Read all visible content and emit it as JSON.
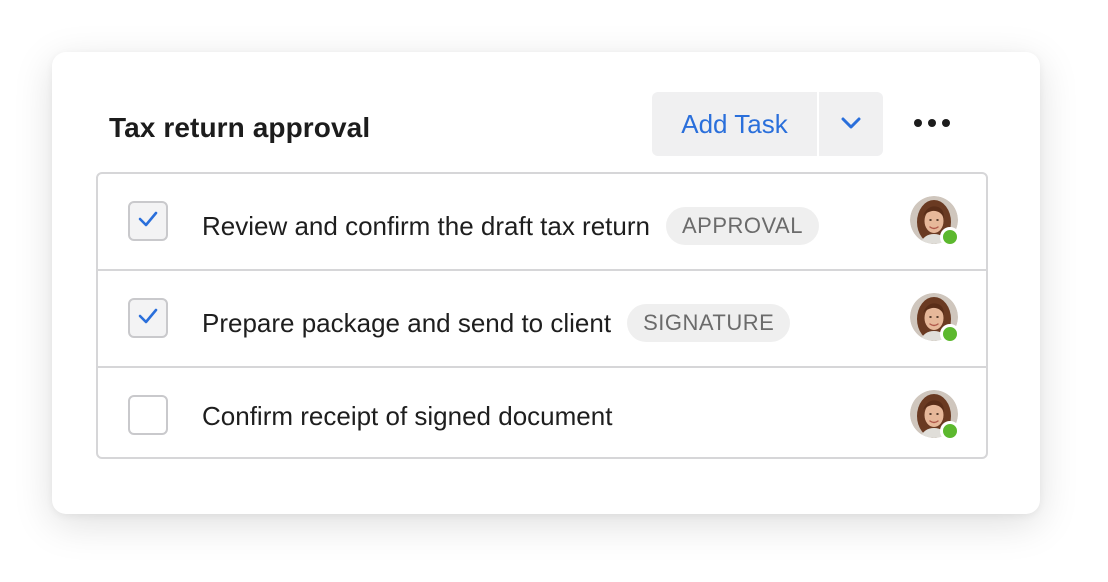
{
  "header": {
    "title": "Tax return approval",
    "add_task_label": "Add Task",
    "dropdown_icon": "chevron-down-icon",
    "more_icon": "more-horizontal-icon"
  },
  "tasks": [
    {
      "label": "Review and confirm the draft tax return",
      "checked": true,
      "badge": "APPROVAL",
      "assignee_status": "online"
    },
    {
      "label": "Prepare package and send to client",
      "checked": true,
      "badge": "SIGNATURE",
      "assignee_status": "online"
    },
    {
      "label": "Confirm receipt of signed document",
      "checked": false,
      "badge": "",
      "assignee_status": "online"
    }
  ],
  "colors": {
    "accent": "#2a6fdb",
    "online": "#5cb82e",
    "badge_bg": "#efefef",
    "badge_text": "#6b6b6b",
    "button_bg": "#f0f0f1"
  }
}
